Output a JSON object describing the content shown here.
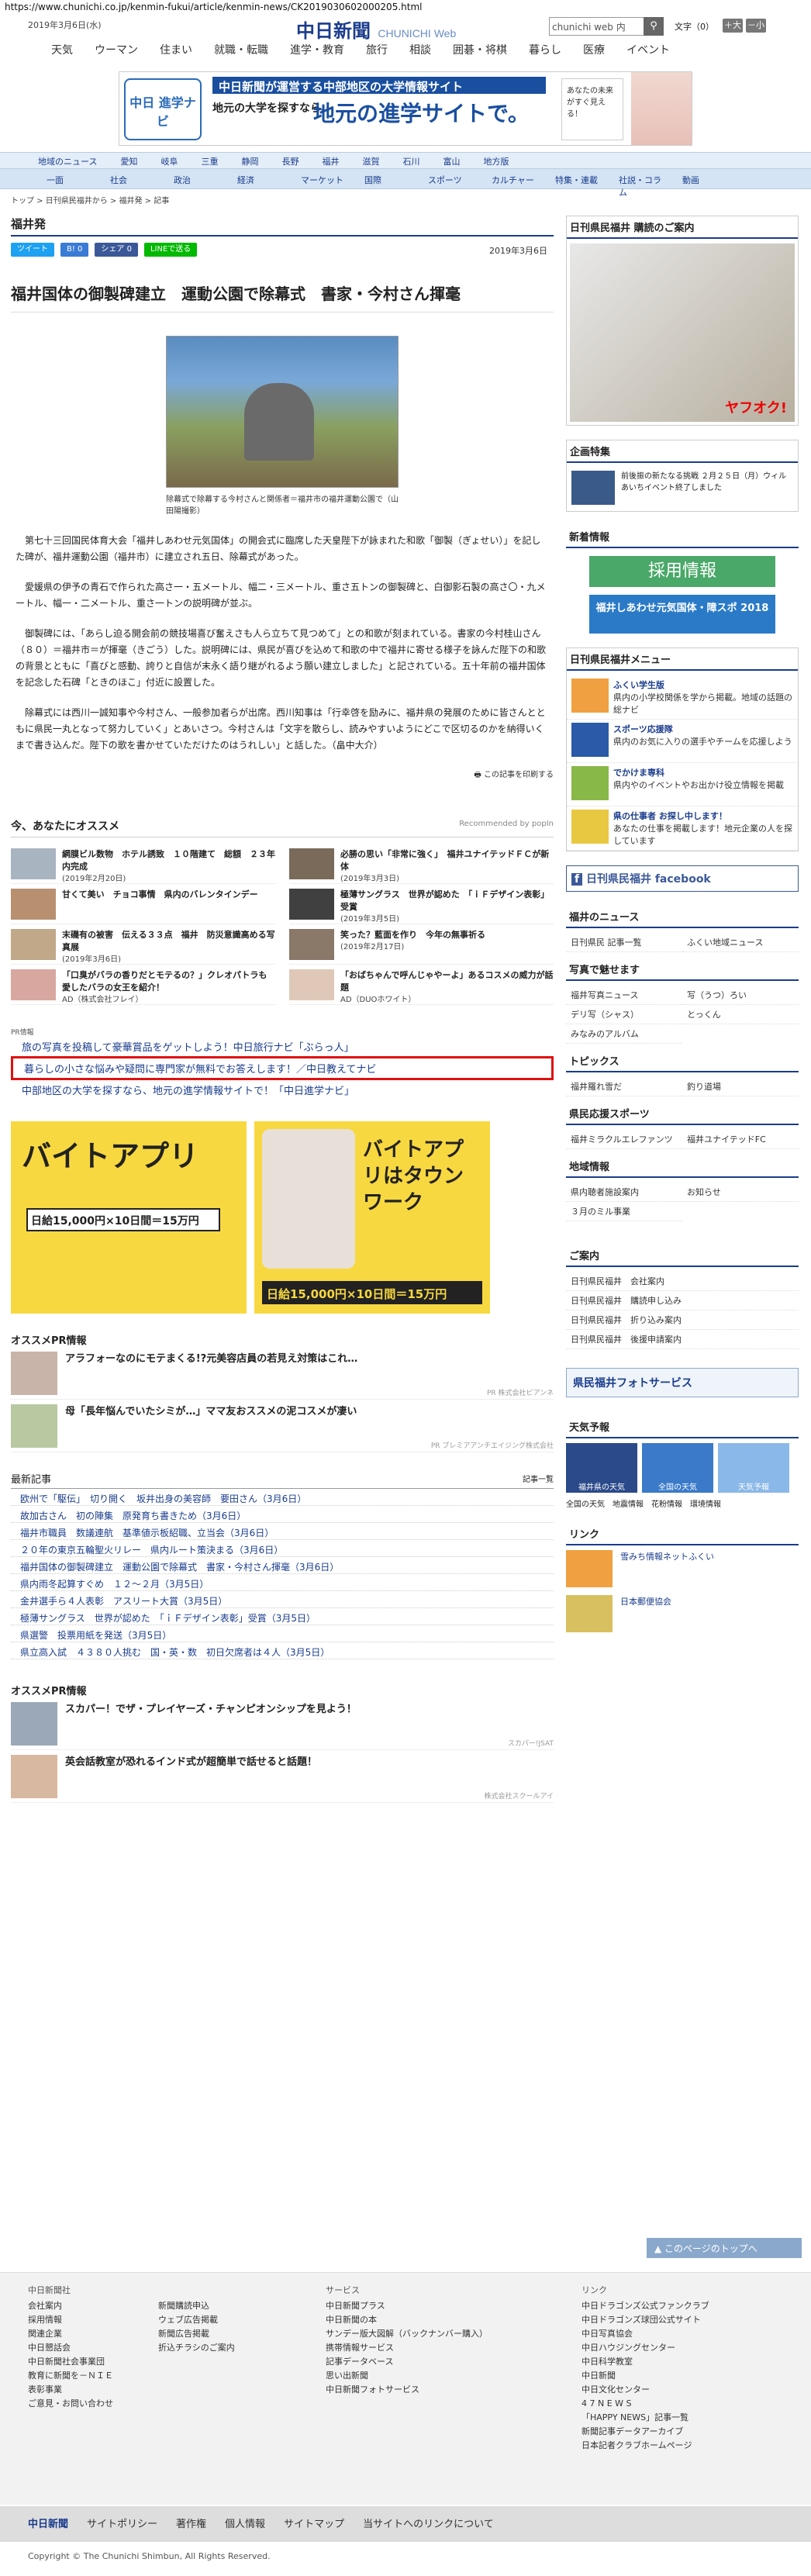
{
  "url": "https://www.chunichi.co.jp/kenmin-fukui/article/kenmin-news/CK2019030602000205.html",
  "header": {
    "date": "2019年3月6日(水)",
    "logo": "中日新聞",
    "logo_sub": "CHUNICHI Web",
    "search_value": "chunichi web 内",
    "fontsize_label": "文字（0）",
    "font_plus": "＋大",
    "font_minus": "－小"
  },
  "gnav": [
    "天気",
    "ウーマン",
    "住まい",
    "就職・転職",
    "進学・教育",
    "旅行",
    "相談",
    "囲碁・将棋",
    "暮らし",
    "医療",
    "イベント"
  ],
  "banner": {
    "logo": "中日 進学ナビ",
    "headline": "中日新聞が運営する中部地区の大学情報サイト",
    "sub": "地元の大学を探すなら、",
    "main": "地元の進学サイトで。",
    "side": "あなたの未来がすぐ見える！"
  },
  "region_tabs": [
    "地域のニュース",
    "愛知",
    "岐阜",
    "三重",
    "静岡",
    "長野",
    "福井",
    "滋賀",
    "石川",
    "富山",
    "地方版"
  ],
  "cat_tabs": [
    "一面",
    "社会",
    "政治",
    "経済",
    "マーケット",
    "国際",
    "スポーツ",
    "カルチャー",
    "特集・連載",
    "社説・コラム",
    "動画"
  ],
  "breadcrumb": [
    "トップ",
    "日刊県民福井から",
    "福井発",
    "記事"
  ],
  "section": "福井発",
  "share": {
    "tweet": "ツイート",
    "b": "B! 0",
    "share": "シェア 0",
    "line": "LINEで送る"
  },
  "article_date": "2019年3月6日",
  "title": "福井国体の御製碑建立　運動公園で除幕式　書家・今村さん揮毫",
  "caption": "除幕式で除幕する今村さんと関係者＝福井市の福井運動公園で（山田陽撮影）",
  "body": [
    "第七十三回国民体育大会「福井しあわせ元気国体」の開会式に臨席した天皇陛下が詠まれた和歌「御製（ぎょせい）」を記した碑が、福井運動公園（福井市）に建立され五日、除幕式があった。",
    "愛媛県の伊予の青石で作られた高さ一・五メートル、幅二・三メートル、重さ五トンの御製碑と、白御影石製の高さ〇・九メートル、幅一・二メートル、重さ一トンの説明碑が並ぶ。",
    "御製碑には、「あらし迫る開会前の競技場喜び奮えさも人ら立ちて見つめて」との和歌が刻まれている。書家の今村桂山さん（８０）＝福井市＝が揮毫（きごう）した。説明碑には、県民が喜びを込めて和歌の中で福井に寄せる様子を詠んだ陛下の和歌の背景とともに「喜びと感動、誇りと自信が末永く語り継がれるよう願い建立しました」と記されている。五十年前の福井国体を記念した石碑「ときのほこ」付近に設置した。",
    "除幕式には西川一誠知事や今村さん、一般参加者らが出席。西川知事は「行幸啓を励みに、福井県の発展のために皆さんとともに県民一丸となって努力していく」とあいさつ。今村さんは「文字を散らし、読みやすいようにどこで区切るのかを納得いくまで書き込んだ。陛下の歌を書かせていただけたのはうれしい」と話した。（畠中大介）"
  ],
  "print_label": "この記事を印刷する",
  "rec": {
    "title": "今、あなたにオススメ",
    "powered": "Recommended by popIn",
    "items": [
      {
        "t": "網膜ビル数物　ホテル誘致　１０階建て　総額　２３年内完成",
        "d": "(2019年2月20日)"
      },
      {
        "t": "必勝の思い「非常に強く」　福井ユナイテッドＦＣが新体",
        "d": "(2019年3月3日)"
      },
      {
        "t": "甘くて美い　チョコ事情　県内のバレンタインデー",
        "d": ""
      },
      {
        "t": "極薄サングラス　世界が認めた　「ｉＦデザイン表彰」受賞",
        "d": "(2019年3月5日)"
      },
      {
        "t": "末磯有の被害　伝える３３点　福井　防災意識高める写真展",
        "d": "(2019年3月6日)"
      },
      {
        "t": "笑った？藍面を作り　今年の無事祈る",
        "d": "(2019年2月17日)"
      },
      {
        "t": "「口臭がバラの香りだとモテるの？」クレオパトラも愛したバラの女王を紹介！",
        "d": "AD（株式会社フレイ）"
      },
      {
        "t": "「おばちゃんで呼んじゃやーよ」あるコスメの威力が話題",
        "d": "AD（DUOホワイト）"
      }
    ]
  },
  "pr": {
    "label": "PR情報",
    "links": [
      "旅の写真を投稿して豪華賞品をゲットしよう！中日旅行ナビ「ぶらっ人」",
      "暮らしの小さな悩みや疑問に専門家が無料でお答えします！／中日教えてナビ",
      "中部地区の大学を探すなら、地元の進学情報サイトで！「中日進学ナビ」"
    ]
  },
  "ads": {
    "a1_title": "バイトアプリ",
    "a1_sub": "日給15,000円×10日間＝15万円",
    "a2_title": "バイトアプリはタウンワーク",
    "a2_sub": "日給15,000円×10日間＝15万円"
  },
  "ospr": {
    "title": "オススメPR情報",
    "items": [
      {
        "t": "アラフォーなのにモテまくる!?元美容店員の若見え対策はこれ…",
        "s": "PR 株式会社ビアンネ"
      },
      {
        "t": "母「長年悩んでいたシミが…」ママ友おススメの泥コスメが凄い",
        "s": "PR プレミアアンチエイジング株式会社"
      }
    ]
  },
  "latest": {
    "title": "最新記事",
    "more": "記事一覧",
    "items": [
      "欧州で「駆伝」　切り開く　坂井出身の美容師　要田さん（3月6日）",
      "故加古さん　初の陣集　原発育ち書きため（3月6日）",
      "福井市職員　数議連航　基準値示板紹職、立当会（3月6日）",
      "２０年の東京五輪聖火リレー　県内ルート策決まる（3月6日）",
      "福井国体の御製碑建立　運動公園で除幕式　書家・今村さん揮毫（3月6日）",
      "県内雨冬起算すぐめ　１２～２月（3月5日）",
      "金井選手ら４人表彰　アスリート大賞（3月5日）",
      "極薄サングラス　世界が認めた　「ｉＦデザイン表彰」受賞（3月5日）",
      "県選警　投票用紙を発送（3月5日）",
      "県立高入試　４３８０人挑む　国・英・数　初日欠席者は４人（3月5日）"
    ]
  },
  "ospr2": {
    "title": "オススメPR情報",
    "items": [
      {
        "t": "スカパー！でザ・プレイヤーズ・チャンピオンシップを見よう！",
        "s": "スカパー!JSAT"
      },
      {
        "t": "英会話教室が恐れるインド式が超簡単で話せると話題！",
        "s": "株式会社スクールアイ"
      }
    ]
  },
  "right": {
    "kenmin": "日刊県民福井 購読のご案内",
    "yahoo": "ヤフオク!",
    "kikaku": "企画特集",
    "kikaku_item": "前後振の新たなる挑戦 ２月２５日（月）ウィルあいちイベント終了しました",
    "shin": "新着情報",
    "saiyo": "採用情報",
    "fukui": "福井しあわせ元気国体・障スポ 2018",
    "menu_title": "日刊県民福井メニュー",
    "menu": [
      {
        "t": "ふくい学生版",
        "d": "県内の小学校関係を学から掲載。地域の話題の総ナビ"
      },
      {
        "t": "スポーツ応援隊",
        "d": "県内のお気に入りの選手やチームを応援しよう"
      },
      {
        "t": "でかけま専科",
        "d": "県内やのイベントやお出かけ役立情報を掲載"
      },
      {
        "t": "県の仕事者 お探し中します！",
        "d": "あなたの仕事を掲載します！地元企業の人を探しています"
      }
    ],
    "fb": "日刊県民福井 facebook",
    "fnews": "福井のニュース",
    "fnews_items": [
      "日刊県民 記事一覧",
      "ふくい地域ニュース"
    ],
    "photo": "写真で魅せます",
    "photo_items": [
      "福井写真ニュース",
      "写（うつ）ろい",
      "デリ写（シャス）",
      "とっくん",
      "みなみのアルバム"
    ],
    "topics": "トピックス",
    "topics_items": [
      "福井羅れ雪だ",
      "釣り道場"
    ],
    "sports": "県民応援スポーツ",
    "sports_items": [
      "福井ミラクルエレファンツ",
      "福井ユナイテッドFC"
    ],
    "chiiki": "地域情報",
    "chiiki_items": [
      "県内聴者施設案内",
      "お知らせ",
      "３月のミル事業"
    ],
    "annai": "ご案内",
    "annai_items": [
      "日刊県民福井　会社案内",
      "日刊県民福井　購読申し込み",
      "日刊県民福井　折り込み案内",
      "日刊県民福井　後援申請案内"
    ],
    "photosv": "県民福井フォトサービス",
    "tenki": "天気予報",
    "tenki_items": [
      "福井県の天気",
      "全国の天気",
      "天気予報"
    ],
    "tenki_sub": [
      "全国の天気",
      "地震情報",
      "花粉情報",
      "環境情報"
    ],
    "link": "リンク",
    "link_items": [
      "雪みち情報ネットふくい",
      "日本郵便協会"
    ]
  },
  "toppage": "このページのトップへ",
  "footer": {
    "c1h": "中日新聞社",
    "c1": [
      "会社案内",
      "採用情報",
      "関連企業",
      "中日懇話会",
      "中日新聞社会事業団",
      "教育に新聞を－ＮＩＥ",
      "表彰事業",
      "ご意見・お問い合わせ"
    ],
    "c2": [
      "新聞購読申込",
      "ウェブ広告掲載",
      "新聞広告掲載",
      "折込チラシのご案内"
    ],
    "c3h": "サービス",
    "c3": [
      "中日新聞プラス",
      "中日新聞の本",
      "サンデー版大図解（バックナンバー購入）",
      "携帯情報サービス",
      "記事データベース",
      "思い出新聞",
      "中日新聞フォトサービス"
    ],
    "c4h": "リンク",
    "c4": [
      "中日ドラゴンズ公式ファンクラブ",
      "中日ドラゴンズ球団公式サイト",
      "中日写真協会",
      "中日ハウジングセンター",
      "中日科学教室",
      "中日新聞",
      "中日文化センター",
      "4 7 N E W S",
      "「HAPPY NEWS」記事一覧",
      "新聞記事データアーカイブ",
      "日本記者クラブホームページ"
    ],
    "bar": [
      "中日新聞",
      "サイトポリシー",
      "著作権",
      "個人情報",
      "サイトマップ",
      "当サイトへのリンクについて"
    ],
    "copy": "Copyright © The Chunichi Shimbun, All Rights Reserved."
  },
  "colors": {
    "brand": "#1a3c8c",
    "highlight": "#e01010",
    "twitter": "#1da1f2",
    "line": "#00b900"
  }
}
